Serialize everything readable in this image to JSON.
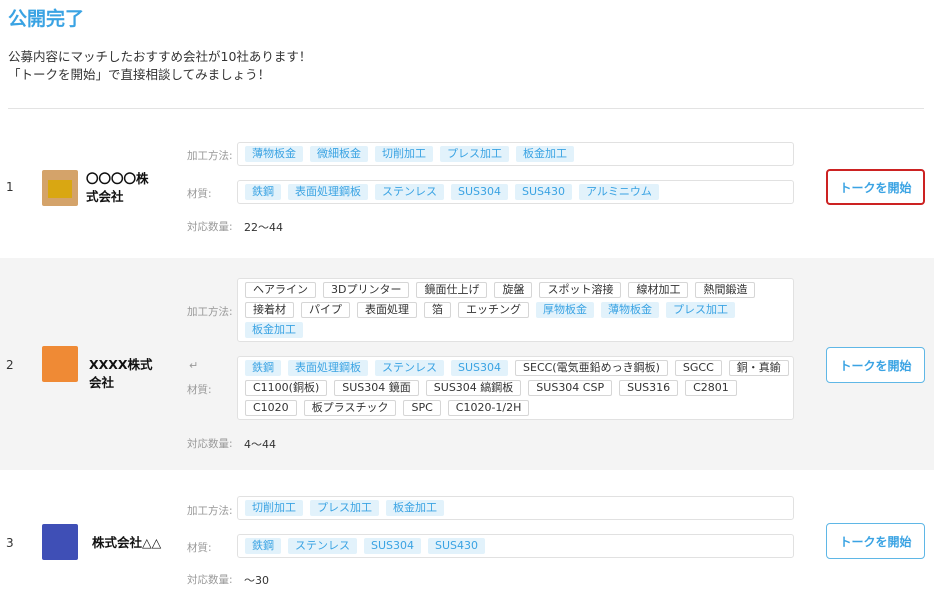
{
  "page": {
    "title": "公開完了",
    "intro_line1": "公募内容にマッチしたおすすめ会社が10社あります！",
    "intro_line2": "「トークを開始」で直接相談してみましょう！"
  },
  "labels": {
    "method": "加工方法:",
    "material": "材質:",
    "quantity": "対応数量:",
    "talk_button": "トークを開始"
  },
  "colors": {
    "accent": "#3aa3e3",
    "highlight_tag_bg": "#e2f2fb",
    "active_border": "#cc2222"
  },
  "companies": [
    {
      "number": "1",
      "name_line1": "〇〇〇〇株",
      "name_line2": "式会社",
      "logo_color": "#d4a36a",
      "logo_inner_color": "#d9a712",
      "methods": [
        {
          "text": "薄物板金",
          "hl": true
        },
        {
          "text": "微細板金",
          "hl": true
        },
        {
          "text": "切削加工",
          "hl": true
        },
        {
          "text": "プレス加工",
          "hl": true
        },
        {
          "text": "板金加工",
          "hl": true
        }
      ],
      "materials": [
        {
          "text": "鉄鋼",
          "hl": true
        },
        {
          "text": "表面処理鋼板",
          "hl": true
        },
        {
          "text": "ステンレス",
          "hl": true
        },
        {
          "text": "SUS304",
          "hl": true
        },
        {
          "text": "SUS430",
          "hl": true
        },
        {
          "text": "アルミニウム",
          "hl": true
        }
      ],
      "quantity": "22〜44"
    },
    {
      "number": "2",
      "name_line1": "XXXX株式",
      "name_line2": "会社",
      "logo_color": "#ef8a35",
      "logo_inner_color": "#ef8a35",
      "return_mark": "↵",
      "methods": [
        {
          "text": "ヘアライン",
          "hl": false
        },
        {
          "text": "3Dプリンター",
          "hl": false
        },
        {
          "text": "鏡面仕上げ",
          "hl": false
        },
        {
          "text": "旋盤",
          "hl": false
        },
        {
          "text": "スポット溶接",
          "hl": false
        },
        {
          "text": "線材加工",
          "hl": false
        },
        {
          "text": "熱間鍛造",
          "hl": false
        },
        {
          "text": "接着材",
          "hl": false
        },
        {
          "text": "パイプ",
          "hl": false
        },
        {
          "text": "表面処理",
          "hl": false
        },
        {
          "text": "箔",
          "hl": false
        },
        {
          "text": "エッチング",
          "hl": false
        },
        {
          "text": "厚物板金",
          "hl": true
        },
        {
          "text": "薄物板金",
          "hl": true
        },
        {
          "text": "プレス加工",
          "hl": true
        },
        {
          "text": "板金加工",
          "hl": true
        }
      ],
      "materials": [
        {
          "text": "鉄鋼",
          "hl": true
        },
        {
          "text": "表面処理鋼板",
          "hl": true
        },
        {
          "text": "ステンレス",
          "hl": true
        },
        {
          "text": "SUS304",
          "hl": true
        },
        {
          "text": "SECC(電気亜鉛めっき鋼板)",
          "hl": false
        },
        {
          "text": "SGCC",
          "hl": false
        },
        {
          "text": "銅・真鍮",
          "hl": false
        },
        {
          "text": "C1100(銅板)",
          "hl": false
        },
        {
          "text": "SUS304 鏡面",
          "hl": false
        },
        {
          "text": "SUS304 縞鋼板",
          "hl": false
        },
        {
          "text": "SUS304 CSP",
          "hl": false
        },
        {
          "text": "SUS316",
          "hl": false
        },
        {
          "text": "C2801",
          "hl": false
        },
        {
          "text": "C1020",
          "hl": false
        },
        {
          "text": "板プラスチック",
          "hl": false
        },
        {
          "text": "SPC",
          "hl": false
        },
        {
          "text": "C1020-1/2H",
          "hl": false
        }
      ],
      "quantity": "4〜44"
    },
    {
      "number": "3",
      "name_line1": "株式会社△△",
      "name_line2": "",
      "logo_color": "#3f4fb6",
      "logo_inner_color": "#3f4fb6",
      "methods": [
        {
          "text": "切削加工",
          "hl": true
        },
        {
          "text": "プレス加工",
          "hl": true
        },
        {
          "text": "板金加工",
          "hl": true
        }
      ],
      "materials": [
        {
          "text": "鉄鋼",
          "hl": true
        },
        {
          "text": "ステンレス",
          "hl": true
        },
        {
          "text": "SUS304",
          "hl": true
        },
        {
          "text": "SUS430",
          "hl": true
        }
      ],
      "quantity": "〜30"
    }
  ]
}
